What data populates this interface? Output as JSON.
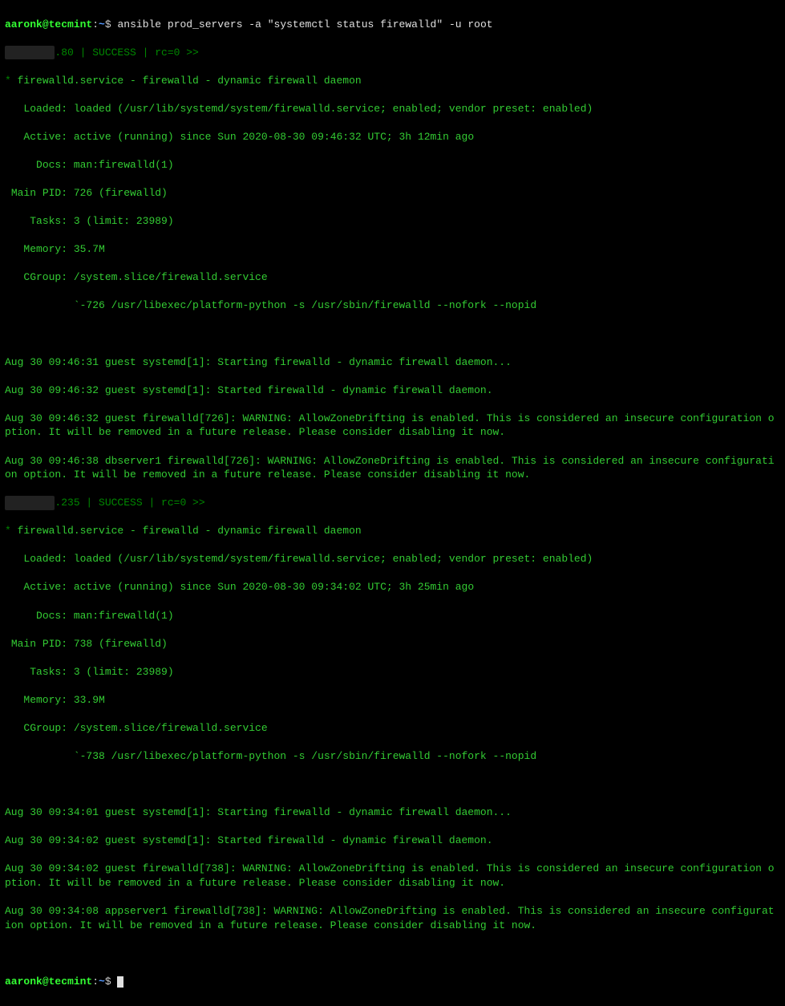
{
  "prompt": {
    "user": "aaronk",
    "at": "@",
    "host": "tecmint",
    "colon": ":",
    "path": "~",
    "dollar": "$"
  },
  "command": "ansible prod_servers -a \"systemctl status firewalld\" -u root",
  "host1": {
    "ip_prefix_redacted": "        ",
    "ip_suffix": ".80 | SUCCESS | rc=0 >>",
    "svc_star": "*",
    "svc_name": " firewalld.service - firewalld - dynamic firewall daemon",
    "loaded": "   Loaded: loaded (/usr/lib/systemd/system/firewalld.service; enabled; vendor preset: enabled)",
    "active_label": "   Active: ",
    "active_state": "active (running)",
    "active_since": " since Sun 2020-08-30 09:46:32 UTC; 3h 12min ago",
    "docs": "     Docs: man:firewalld(1)",
    "mainpid": " Main PID: 726 (firewalld)",
    "tasks": "    Tasks: 3 (limit: 23989)",
    "memory": "   Memory: 35.7M",
    "cgroup": "   CGroup: /system.slice/firewalld.service",
    "cgroup2": "           `-726 /usr/libexec/platform-python -s /usr/sbin/firewalld --nofork --nopid",
    "log1": "Aug 30 09:46:31 guest systemd[1]: Starting firewalld - dynamic firewall daemon...",
    "log2": "Aug 30 09:46:32 guest systemd[1]: Started firewalld - dynamic firewall daemon.",
    "log3": "Aug 30 09:46:32 guest firewalld[726]: WARNING: AllowZoneDrifting is enabled. This is considered an insecure configuration option. It will be removed in a future release. Please consider disabling it now.",
    "log4": "Aug 30 09:46:38 dbserver1 firewalld[726]: WARNING: AllowZoneDrifting is enabled. This is considered an insecure configuration option. It will be removed in a future release. Please consider disabling it now."
  },
  "host2": {
    "ip_prefix_redacted": "        ",
    "ip_suffix": ".235 | SUCCESS | rc=0 >>",
    "svc_star": "*",
    "svc_name": " firewalld.service - firewalld - dynamic firewall daemon",
    "loaded": "   Loaded: loaded (/usr/lib/systemd/system/firewalld.service; enabled; vendor preset: enabled)",
    "active_label": "   Active: ",
    "active_state": "active (running)",
    "active_since": " since Sun 2020-08-30 09:34:02 UTC; 3h 25min ago",
    "docs": "     Docs: man:firewalld(1)",
    "mainpid": " Main PID: 738 (firewalld)",
    "tasks": "    Tasks: 3 (limit: 23989)",
    "memory": "   Memory: 33.9M",
    "cgroup": "   CGroup: /system.slice/firewalld.service",
    "cgroup2": "           `-738 /usr/libexec/platform-python -s /usr/sbin/firewalld --nofork --nopid",
    "log1": "Aug 30 09:34:01 guest systemd[1]: Starting firewalld - dynamic firewall daemon...",
    "log2": "Aug 30 09:34:02 guest systemd[1]: Started firewalld - dynamic firewall daemon.",
    "log3": "Aug 30 09:34:02 guest firewalld[738]: WARNING: AllowZoneDrifting is enabled. This is considered an insecure configuration option. It will be removed in a future release. Please consider disabling it now.",
    "log4": "Aug 30 09:34:08 appserver1 firewalld[738]: WARNING: AllowZoneDrifting is enabled. This is considered an insecure configuration option. It will be removed in a future release. Please consider disabling it now."
  }
}
